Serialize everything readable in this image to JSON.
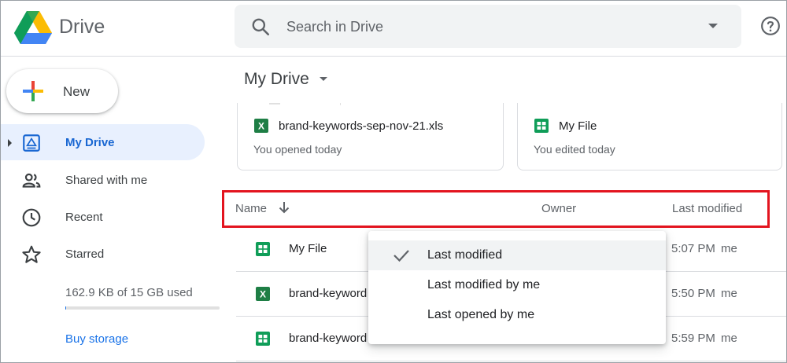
{
  "header": {
    "app_name": "Drive",
    "search_placeholder": "Search in Drive"
  },
  "sidebar": {
    "new_label": "New",
    "items": [
      {
        "label": "My Drive",
        "icon": "my-drive-icon",
        "active": true
      },
      {
        "label": "Shared with me",
        "icon": "shared-icon"
      },
      {
        "label": "Recent",
        "icon": "clock-icon"
      },
      {
        "label": "Starred",
        "icon": "star-icon"
      }
    ],
    "storage": {
      "text": "162.9 KB of 15 GB used",
      "used_fraction": 1e-05
    },
    "buy_storage": "Buy storage"
  },
  "main": {
    "title": "My Drive",
    "suggested": [
      {
        "name": "brand-keywords-sep-nov-21.xls",
        "subtitle": "You opened today",
        "type": "excel"
      },
      {
        "name": "My File",
        "subtitle": "You edited today",
        "type": "sheets"
      }
    ],
    "columns": {
      "name": "Name",
      "owner": "Owner",
      "modified": "Last modified"
    },
    "rows": [
      {
        "name": "My File",
        "time": "5:07 PM",
        "by": "me",
        "type": "sheets"
      },
      {
        "name": "brand-keyword",
        "time": "5:50 PM",
        "by": "me",
        "type": "excel"
      },
      {
        "name": "brand-keyword",
        "time": "5:59 PM",
        "by": "me",
        "type": "sheets"
      }
    ]
  },
  "sort_menu": {
    "items": [
      {
        "label": "Last modified",
        "selected": true
      },
      {
        "label": "Last modified by me"
      },
      {
        "label": "Last opened by me"
      }
    ]
  },
  "colors": {
    "accent": "#1a73e8",
    "active_nav_bg": "#e8f0fe",
    "highlight": "#e3141f",
    "sheets_green": "#0f9d58",
    "excel_green": "#1e7e45"
  }
}
